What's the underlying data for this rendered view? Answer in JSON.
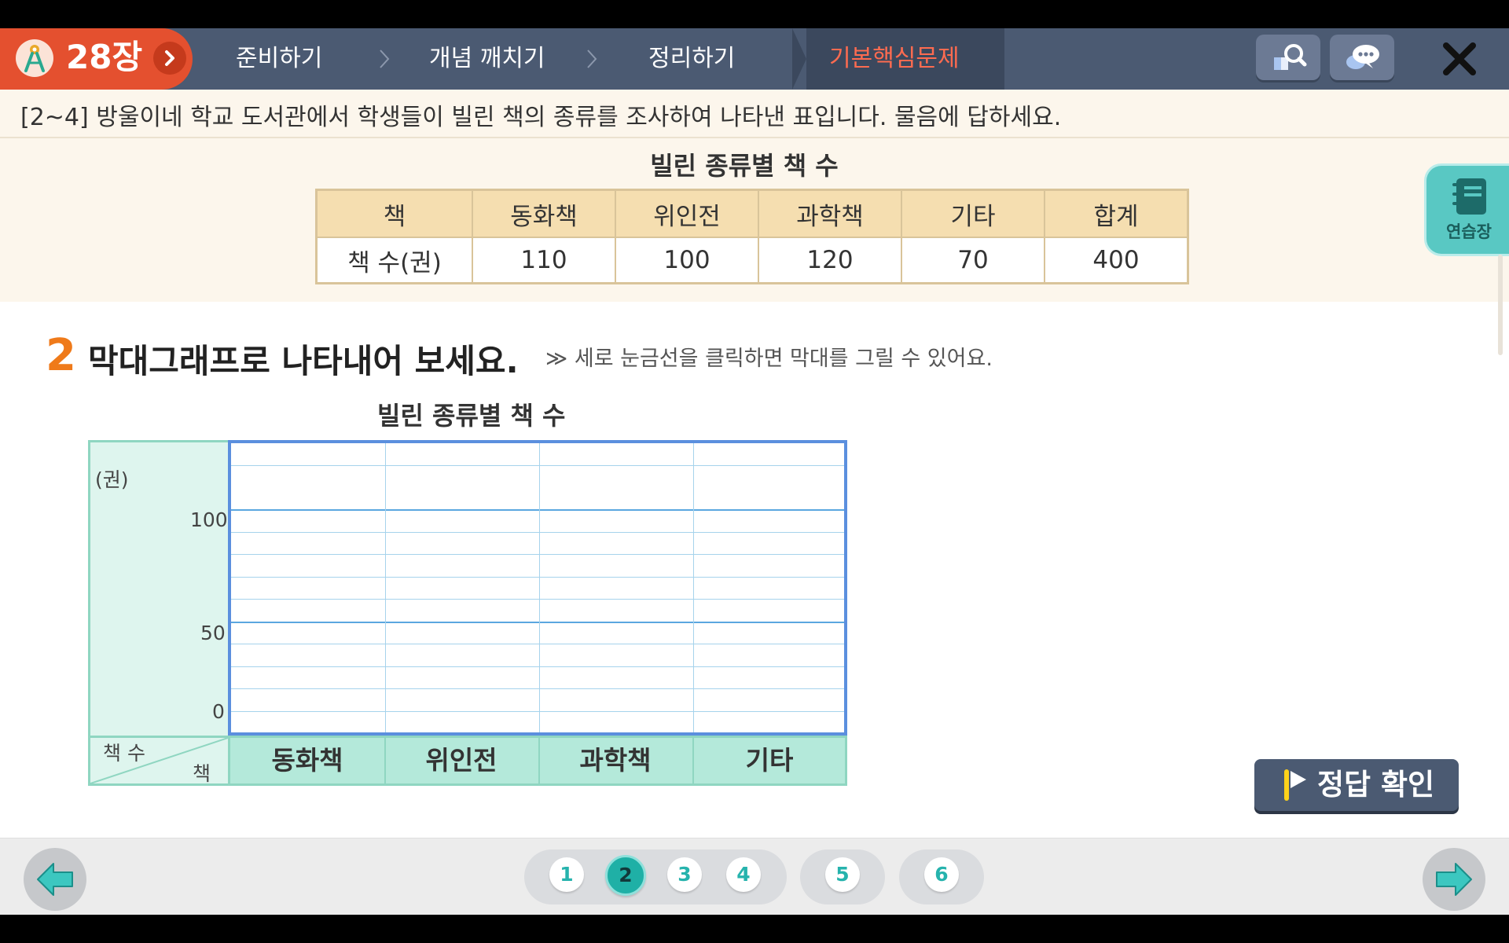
{
  "header": {
    "chapter": "28장",
    "nav": [
      "준비하기",
      "개념 깨치기",
      "정리하기",
      "기본핵심문제"
    ],
    "active_index": 3,
    "search_icon": "book-search-icon",
    "chat_icon": "chat-bubble-icon",
    "close_icon": "close-icon"
  },
  "question": {
    "text": "[2~4] 방울이네 학교 도서관에서 학생들이 빌린 책의 종류를 조사하여 나타낸 표입니다. 물음에 답하세요.",
    "table_title": "빌린 종류별 책 수",
    "table": {
      "headers": [
        "책",
        "동화책",
        "위인전",
        "과학책",
        "기타",
        "합계"
      ],
      "row_label": "책 수(권)",
      "values": [
        "110",
        "100",
        "120",
        "70",
        "400"
      ]
    }
  },
  "memo": {
    "label": "연습장"
  },
  "problem": {
    "number": "2",
    "text": "막대그래프로 나타내어 보세요.",
    "hint_marker": "≫",
    "hint": "세로 눈금선을 클릭하면 막대를 그릴 수 있어요."
  },
  "graph": {
    "title": "빌린 종류별 책 수",
    "unit": "(권)",
    "y_label_100": "100",
    "y_label_50": "50",
    "y_label_0": "0",
    "corner_top": "책 수",
    "corner_bottom": "책",
    "categories": [
      "동화책",
      "위인전",
      "과학책",
      "기타"
    ]
  },
  "answer_button": "정답 확인",
  "pagination": [
    "1",
    "2",
    "3",
    "4",
    "5",
    "6"
  ],
  "current_page": "2",
  "colors": {
    "header": "#4b5a72",
    "chapter_badge": "#e4502f",
    "active_tab_text": "#ff6b50",
    "accent_teal": "#1fb0a6",
    "graph_border": "#5b8fde"
  }
}
